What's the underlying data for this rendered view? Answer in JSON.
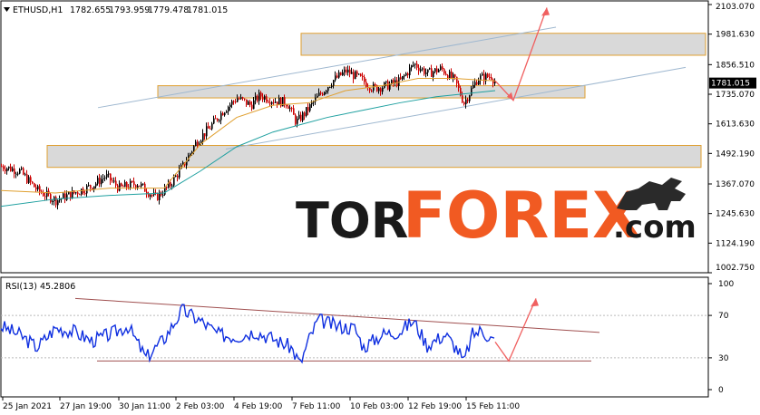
{
  "chart_data": [
    {
      "type": "candlestick",
      "symbol": "ETHUSD,H1",
      "ohlc": {
        "open": "1782.655",
        "high": "1793.959",
        "low": "1779.478",
        "close": "1781.015"
      },
      "price_label": "1781.015",
      "y_ticks": [
        "2103.070",
        "1981.630",
        "1856.510",
        "1735.070",
        "1613.630",
        "1492.190",
        "1367.070",
        "1245.630",
        "1124.190",
        "1002.750"
      ],
      "y_tick_values": [
        2103.07,
        1981.63,
        1856.51,
        1735.07,
        1613.63,
        1492.19,
        1367.07,
        1245.63,
        1124.19,
        1002.75
      ],
      "ylim": [
        1002.75,
        2103.07
      ],
      "x_ticks": [
        "25 Jan 2021",
        "27 Jan 19:00",
        "30 Jan 11:00",
        "2 Feb 03:00",
        "4 Feb 19:00",
        "7 Feb 11:00",
        "10 Feb 03:00",
        "12 Feb 19:00",
        "15 Feb 11:00"
      ],
      "close_path": [
        [
          0,
          1440
        ],
        [
          20,
          1420
        ],
        [
          40,
          1340
        ],
        [
          60,
          1300
        ],
        [
          80,
          1330
        ],
        [
          100,
          1360
        ],
        [
          115,
          1400
        ],
        [
          130,
          1350
        ],
        [
          150,
          1370
        ],
        [
          170,
          1310
        ],
        [
          185,
          1360
        ],
        [
          200,
          1440
        ],
        [
          215,
          1540
        ],
        [
          230,
          1600
        ],
        [
          245,
          1670
        ],
        [
          260,
          1720
        ],
        [
          275,
          1690
        ],
        [
          285,
          1730
        ],
        [
          300,
          1710
        ],
        [
          315,
          1700
        ],
        [
          325,
          1620
        ],
        [
          335,
          1660
        ],
        [
          350,
          1730
        ],
        [
          365,
          1790
        ],
        [
          380,
          1830
        ],
        [
          395,
          1800
        ],
        [
          410,
          1760
        ],
        [
          425,
          1770
        ],
        [
          440,
          1790
        ],
        [
          455,
          1860
        ],
        [
          470,
          1820
        ],
        [
          485,
          1840
        ],
        [
          500,
          1790
        ],
        [
          510,
          1700
        ],
        [
          525,
          1800
        ],
        [
          540,
          1810
        ],
        [
          545,
          1781
        ]
      ],
      "ma_slow": [
        [
          0,
          1275
        ],
        [
          60,
          1305
        ],
        [
          120,
          1320
        ],
        [
          180,
          1330
        ],
        [
          220,
          1420
        ],
        [
          260,
          1520
        ],
        [
          300,
          1580
        ],
        [
          330,
          1610
        ],
        [
          360,
          1640
        ],
        [
          400,
          1670
        ],
        [
          440,
          1700
        ],
        [
          480,
          1725
        ],
        [
          520,
          1740
        ],
        [
          545,
          1750
        ]
      ],
      "ma_fast": [
        [
          0,
          1340
        ],
        [
          60,
          1330
        ],
        [
          120,
          1350
        ],
        [
          180,
          1350
        ],
        [
          220,
          1530
        ],
        [
          260,
          1640
        ],
        [
          300,
          1690
        ],
        [
          340,
          1700
        ],
        [
          380,
          1750
        ],
        [
          420,
          1770
        ],
        [
          460,
          1800
        ],
        [
          500,
          1800
        ],
        [
          545,
          1790
        ]
      ],
      "zones": [
        {
          "from": 1895,
          "to": 1985,
          "x0": 332,
          "x1": 778
        },
        {
          "from": 1720,
          "to": 1770,
          "x0": 174,
          "x1": 645
        },
        {
          "from": 1435,
          "to": 1525,
          "x0": 52,
          "x1": 773
        }
      ],
      "channel_upper": [
        [
          107,
          1680
        ],
        [
          612,
          2010
        ]
      ],
      "channel_lower": [
        [
          248,
          1510
        ],
        [
          755,
          1845
        ]
      ],
      "forecast_arrow": [
        [
          545,
          1790
        ],
        [
          565,
          1710
        ],
        [
          602,
          2090
        ]
      ],
      "brand": {
        "tor": "TOR",
        "forex": "FOREX",
        "com": ".com"
      }
    },
    {
      "type": "line",
      "title": "RSI(13) 45.2806",
      "y_ticks": [
        "100",
        "70",
        "30",
        "0"
      ],
      "y_tick_values": [
        100,
        70,
        30,
        0
      ],
      "ylim": [
        0,
        100
      ],
      "levels": [
        30,
        70
      ],
      "rsi_path": [
        [
          0,
          60
        ],
        [
          20,
          52
        ],
        [
          40,
          40
        ],
        [
          60,
          58
        ],
        [
          80,
          55
        ],
        [
          100,
          46
        ],
        [
          120,
          52
        ],
        [
          140,
          60
        ],
        [
          160,
          30
        ],
        [
          180,
          48
        ],
        [
          200,
          75
        ],
        [
          220,
          65
        ],
        [
          240,
          52
        ],
        [
          260,
          50
        ],
        [
          280,
          55
        ],
        [
          300,
          48
        ],
        [
          320,
          40
        ],
        [
          330,
          24
        ],
        [
          340,
          48
        ],
        [
          350,
          66
        ],
        [
          370,
          60
        ],
        [
          390,
          58
        ],
        [
          400,
          40
        ],
        [
          420,
          52
        ],
        [
          440,
          55
        ],
        [
          455,
          65
        ],
        [
          470,
          42
        ],
        [
          490,
          52
        ],
        [
          505,
          36
        ],
        [
          510,
          25
        ],
        [
          520,
          52
        ],
        [
          530,
          56
        ],
        [
          545,
          45
        ]
      ],
      "trend_upper": [
        [
          82,
          86
        ],
        [
          660,
          54
        ]
      ],
      "trend_lower": [
        [
          106,
          27
        ],
        [
          651,
          27
        ]
      ],
      "forecast_arrow": [
        [
          545,
          45
        ],
        [
          560,
          27
        ],
        [
          590,
          86
        ]
      ]
    }
  ]
}
